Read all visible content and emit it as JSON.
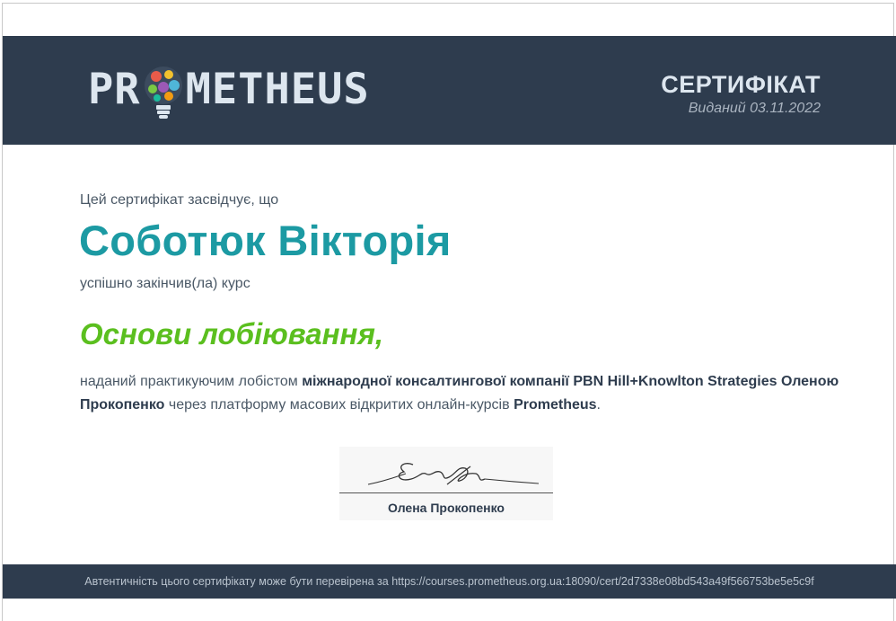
{
  "header": {
    "logo_left": "PR",
    "logo_right": "METHEUS",
    "title": "СЕРТИФІКАТ",
    "issued": "Виданий 03.11.2022"
  },
  "body": {
    "certifies": "Цей сертифікат засвідчує, що",
    "recipient": "Соботюк Вікторія",
    "completed": "успішно закінчив(ла) курс",
    "course": "Основи лобіювання,",
    "desc_part1": "наданий практикуючим лобістом ",
    "desc_bold1": "міжнародної консалтингової компанії PBN Hill+Knowlton Strategies Оленою Прокопенко",
    "desc_part2": " через платформу масових відкритих онлайн-курсів ",
    "desc_bold2": "Prometheus",
    "desc_part3": "."
  },
  "signature": {
    "name": "Олена Прокопенко"
  },
  "footer": {
    "verification": "Автентичність цього сертифікату може бути перевірена за https://courses.prometheus.org.ua:18090/cert/2d7338e08bd543a49f566753be5e5c9f"
  },
  "colors": {
    "header_bg": "#2e3c4e",
    "name_teal": "#1c9aa3",
    "course_green": "#5bbf1f"
  }
}
